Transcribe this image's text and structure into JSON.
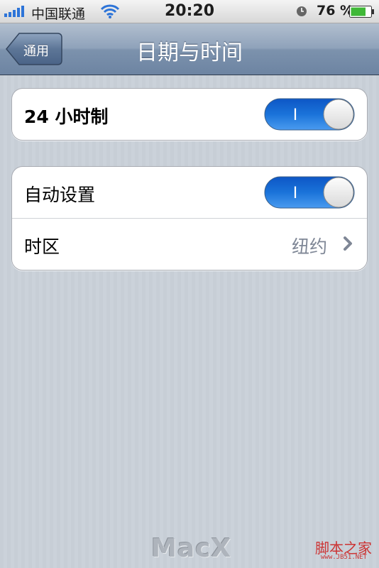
{
  "status_bar": {
    "carrier": "中国联通",
    "time": "20:20",
    "battery_percent": "76 %",
    "battery_level": 0.76,
    "signal_icon": "signal-bars-icon",
    "wifi_icon": "wifi-icon",
    "alarm_icon": "clock-icon",
    "battery_icon": "battery-icon"
  },
  "nav": {
    "back_label": "通用",
    "title": "日期与时间"
  },
  "group1": {
    "row_24h": {
      "label": "24 小时制",
      "toggle_on": true,
      "toggle_text": "I"
    }
  },
  "group2": {
    "row_auto": {
      "label": "自动设置",
      "toggle_on": true,
      "toggle_text": "I"
    },
    "row_timezone": {
      "label": "时区",
      "value": "纽约",
      "icon": "chevron-right-icon"
    }
  },
  "watermarks": {
    "macx": "MacX",
    "jb51": "脚本之家",
    "jb51_url": "www.JB51.NET"
  },
  "colors": {
    "toggle_on": "#1a73d9",
    "nav_bar": "#7c92ad",
    "background": "#c5ccd4"
  }
}
